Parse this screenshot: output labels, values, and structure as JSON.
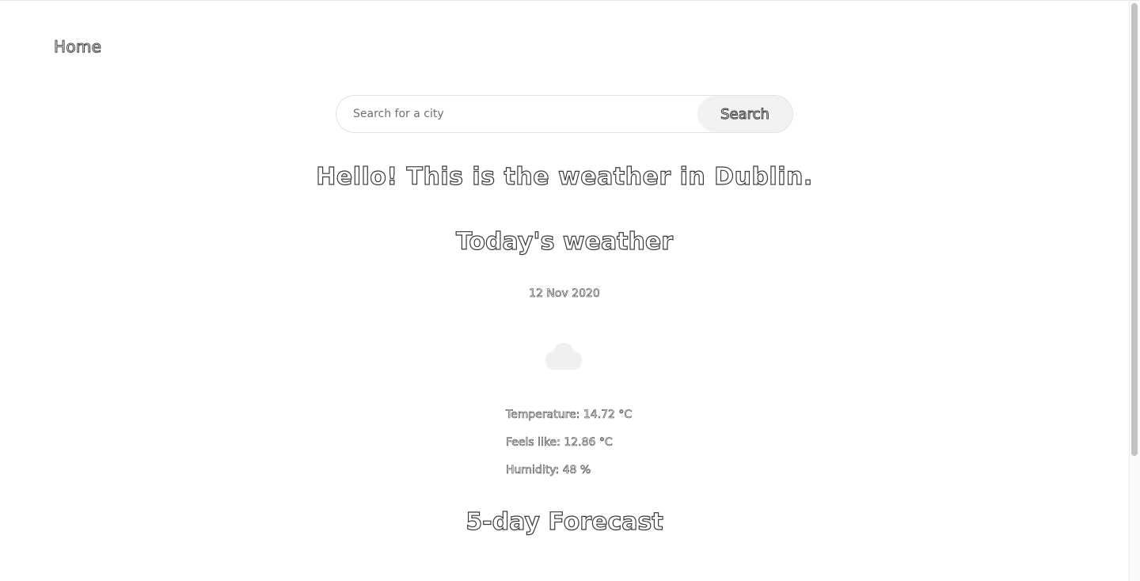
{
  "nav": {
    "home_label": "Home"
  },
  "search": {
    "placeholder": "Search for a city",
    "value": "",
    "button_label": "Search"
  },
  "main": {
    "greeting": "Hello! This is the weather in Dublin.",
    "today_title": "Today's weather",
    "date": "12 Nov 2020",
    "weather_icon": "cloud-icon",
    "details": {
      "temperature": "Temperature: 14.72 °C",
      "feels_like": "Feels like: 12.86 °C",
      "humidity": "Humidity: 48 %"
    },
    "forecast_title": "5-day Forecast"
  },
  "colors": {
    "text_outline": "#3a3a3a",
    "cloud": "#f0f0f0",
    "search_button_bg": "#f2f2f2"
  }
}
